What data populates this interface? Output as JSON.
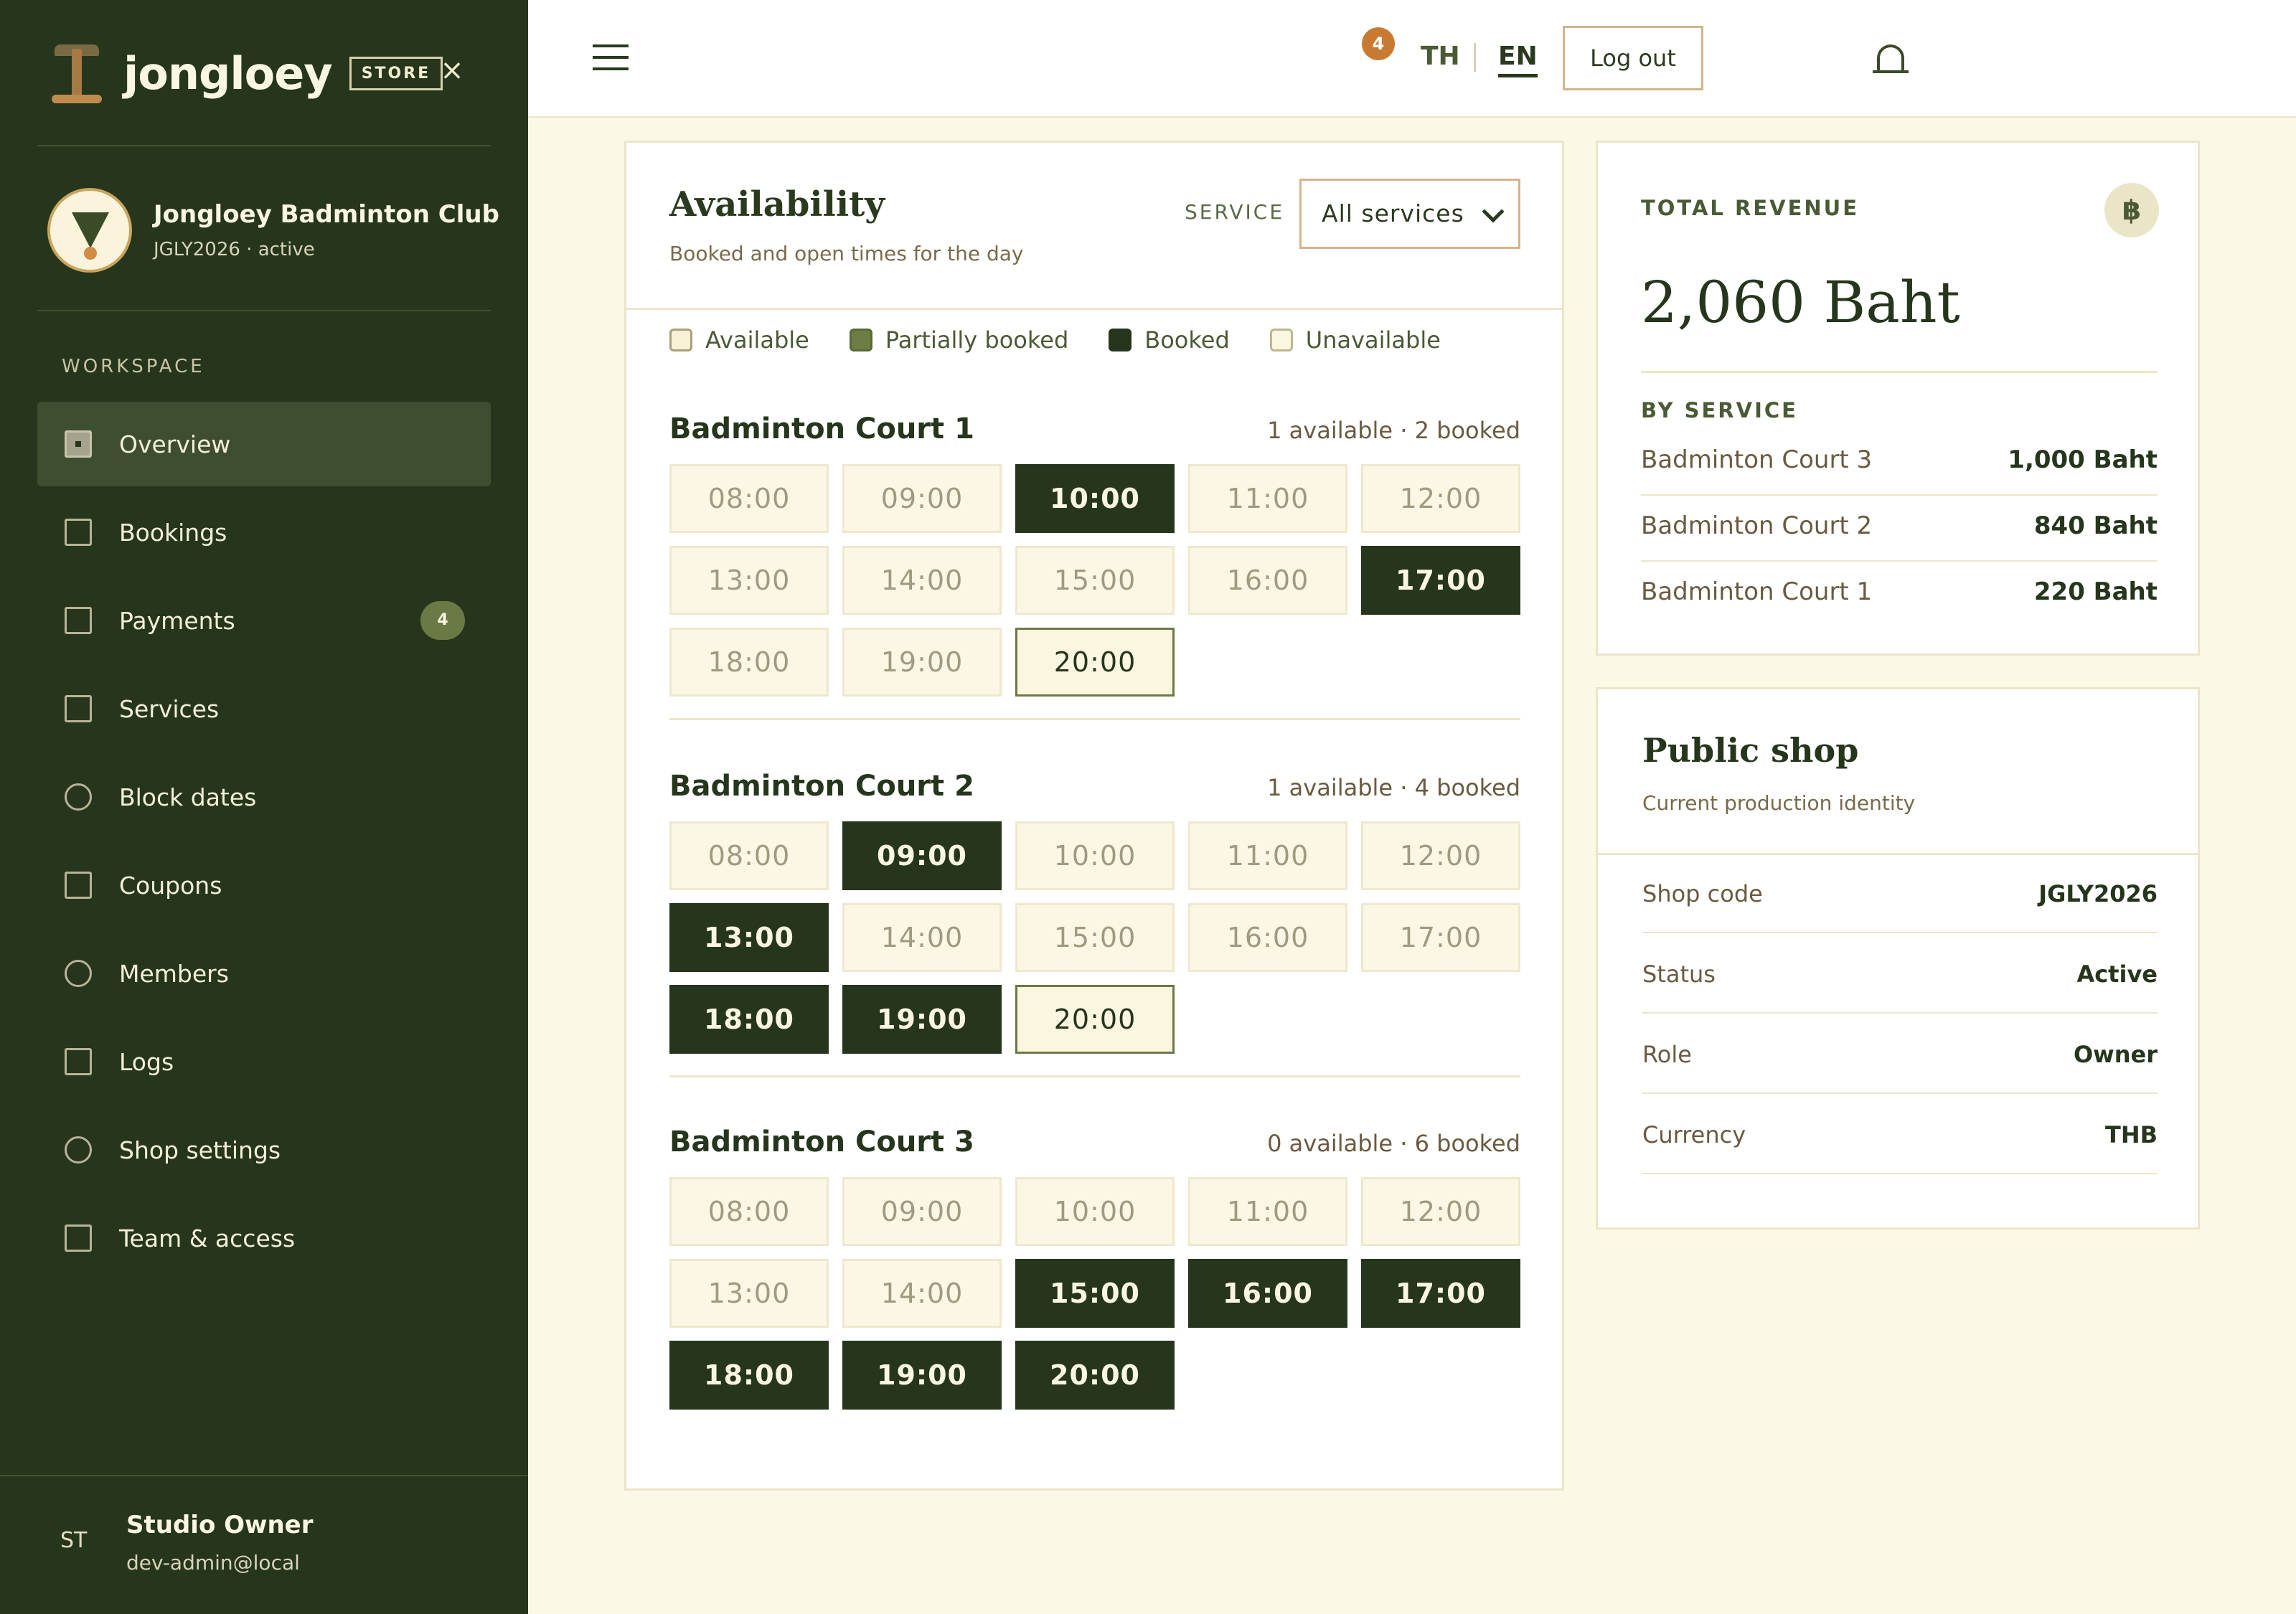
{
  "brand": {
    "name": "jongloey",
    "store_label": "STORE",
    "close_glyph": "×"
  },
  "club": {
    "name": "Jongloey Badminton Club",
    "sub": "JGLY2026 · active"
  },
  "sidebar": {
    "section_label": "WORKSPACE",
    "items": [
      {
        "label": "Overview",
        "icon": "overview-icon",
        "active": true
      },
      {
        "label": "Bookings",
        "icon": "bookings-icon"
      },
      {
        "label": "Payments",
        "icon": "payments-icon",
        "badge": "4"
      },
      {
        "label": "Services",
        "icon": "services-icon"
      },
      {
        "label": "Block dates",
        "icon": "block-dates-icon"
      },
      {
        "label": "Coupons",
        "icon": "coupons-icon"
      },
      {
        "label": "Members",
        "icon": "members-icon"
      },
      {
        "label": "Logs",
        "icon": "logs-icon"
      },
      {
        "label": "Shop settings",
        "icon": "shop-settings-icon"
      },
      {
        "label": "Team & access",
        "icon": "team-access-icon"
      }
    ]
  },
  "user": {
    "initials": "ST",
    "name": "Studio Owner",
    "email": "dev-admin@local"
  },
  "header": {
    "notification_count": "4",
    "lang_th": "TH",
    "lang_en": "EN",
    "logout_label": "Log out"
  },
  "availability": {
    "title": "Availability",
    "subtitle": "Booked and open times for the day",
    "service_label": "SERVICE",
    "service_value": "All services",
    "legend": {
      "available": "Available",
      "partial": "Partially booked",
      "booked": "Booked",
      "unavailable": "Unavailable"
    },
    "courts": [
      {
        "name": "Badminton Court 1",
        "count": "1 available · 2 booked",
        "slots": [
          {
            "time": "08:00",
            "state": "unavailable"
          },
          {
            "time": "09:00",
            "state": "unavailable"
          },
          {
            "time": "10:00",
            "state": "booked"
          },
          {
            "time": "11:00",
            "state": "unavailable"
          },
          {
            "time": "12:00",
            "state": "unavailable"
          },
          {
            "time": "13:00",
            "state": "unavailable"
          },
          {
            "time": "14:00",
            "state": "unavailable"
          },
          {
            "time": "15:00",
            "state": "unavailable"
          },
          {
            "time": "16:00",
            "state": "unavailable"
          },
          {
            "time": "17:00",
            "state": "booked"
          },
          {
            "time": "18:00",
            "state": "unavailable"
          },
          {
            "time": "19:00",
            "state": "unavailable"
          },
          {
            "time": "20:00",
            "state": "available"
          }
        ]
      },
      {
        "name": "Badminton Court 2",
        "count": "1 available · 4 booked",
        "slots": [
          {
            "time": "08:00",
            "state": "unavailable"
          },
          {
            "time": "09:00",
            "state": "booked"
          },
          {
            "time": "10:00",
            "state": "unavailable"
          },
          {
            "time": "11:00",
            "state": "unavailable"
          },
          {
            "time": "12:00",
            "state": "unavailable"
          },
          {
            "time": "13:00",
            "state": "booked"
          },
          {
            "time": "14:00",
            "state": "unavailable"
          },
          {
            "time": "15:00",
            "state": "unavailable"
          },
          {
            "time": "16:00",
            "state": "unavailable"
          },
          {
            "time": "17:00",
            "state": "unavailable"
          },
          {
            "time": "18:00",
            "state": "booked"
          },
          {
            "time": "19:00",
            "state": "booked"
          },
          {
            "time": "20:00",
            "state": "available"
          }
        ]
      },
      {
        "name": "Badminton Court 3",
        "count": "0 available · 6 booked",
        "slots": [
          {
            "time": "08:00",
            "state": "unavailable"
          },
          {
            "time": "09:00",
            "state": "unavailable"
          },
          {
            "time": "10:00",
            "state": "unavailable"
          },
          {
            "time": "11:00",
            "state": "unavailable"
          },
          {
            "time": "12:00",
            "state": "unavailable"
          },
          {
            "time": "13:00",
            "state": "unavailable"
          },
          {
            "time": "14:00",
            "state": "unavailable"
          },
          {
            "time": "15:00",
            "state": "booked"
          },
          {
            "time": "16:00",
            "state": "booked"
          },
          {
            "time": "17:00",
            "state": "booked"
          },
          {
            "time": "18:00",
            "state": "booked"
          },
          {
            "time": "19:00",
            "state": "booked"
          },
          {
            "time": "20:00",
            "state": "booked"
          }
        ]
      }
    ]
  },
  "revenue": {
    "label": "TOTAL REVENUE",
    "icon": "baht-icon",
    "icon_glyph": "฿",
    "amount": "2,060 Baht",
    "by_service_label": "BY SERVICE",
    "rows": [
      {
        "name": "Badminton Court 3",
        "value": "1,000 Baht"
      },
      {
        "name": "Badminton Court 2",
        "value": "840 Baht"
      },
      {
        "name": "Badminton Court 1",
        "value": "220 Baht"
      }
    ]
  },
  "shop": {
    "title": "Public shop",
    "subtitle": "Current production identity",
    "rows": [
      {
        "key": "Shop code",
        "value": "JGLY2026"
      },
      {
        "key": "Status",
        "value": "Active"
      },
      {
        "key": "Role",
        "value": "Owner"
      },
      {
        "key": "Currency",
        "value": "THB"
      }
    ]
  },
  "colors": {
    "sidebar_bg": "#26361c",
    "page_bg": "#fcf8e6",
    "booked": "#26361c",
    "accent": "#c97a32",
    "border_accent": "#d3b48a"
  }
}
